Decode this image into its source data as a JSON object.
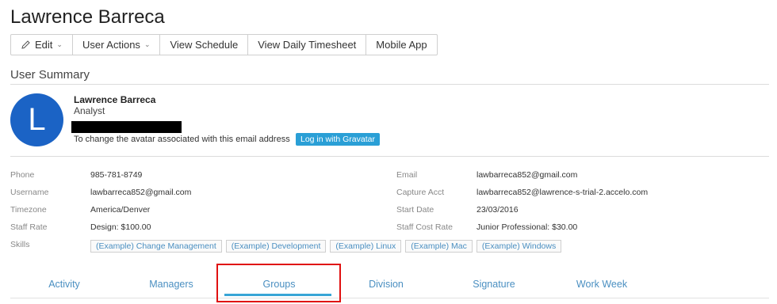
{
  "page": {
    "title": "Lawrence Barreca"
  },
  "toolbar": {
    "edit": "Edit",
    "user_actions": "User Actions",
    "view_schedule": "View Schedule",
    "view_daily_timesheet": "View Daily Timesheet",
    "mobile_app": "Mobile App"
  },
  "summary": {
    "section_title": "User Summary",
    "avatar_letter": "L",
    "name": "Lawrence Barreca",
    "role": "Analyst",
    "avatar_note": "To change the avatar associated with this email address",
    "gravatar_button": "Log in with Gravatar"
  },
  "details_left": [
    {
      "label": "Phone",
      "value": "985-781-8749"
    },
    {
      "label": "Username",
      "value": "lawbarreca852@gmail.com"
    },
    {
      "label": "Timezone",
      "value": "America/Denver"
    },
    {
      "label": "Staff Rate",
      "value": "Design: $100.00"
    }
  ],
  "details_right": [
    {
      "label": "Email",
      "value": "lawbarreca852@gmail.com"
    },
    {
      "label": "Capture Acct",
      "value": "lawbarreca852@lawrence-s-trial-2.accelo.com"
    },
    {
      "label": "Start Date",
      "value": "23/03/2016"
    },
    {
      "label": "Staff Cost Rate",
      "value": "Junior Professional: $30.00"
    }
  ],
  "skills": {
    "label": "Skills",
    "items": [
      "(Example) Change Management",
      "(Example) Development",
      "(Example) Linux",
      "(Example) Mac",
      "(Example) Windows"
    ]
  },
  "tabs": [
    {
      "label": "Activity"
    },
    {
      "label": "Managers"
    },
    {
      "label": "Groups",
      "active": true
    },
    {
      "label": "Division"
    },
    {
      "label": "Signature"
    },
    {
      "label": "Work Week"
    }
  ],
  "colors": {
    "avatar": "#1b63c5",
    "accent": "#2a9fd6",
    "link": "#4a8fc1",
    "highlight": "#e01010"
  }
}
